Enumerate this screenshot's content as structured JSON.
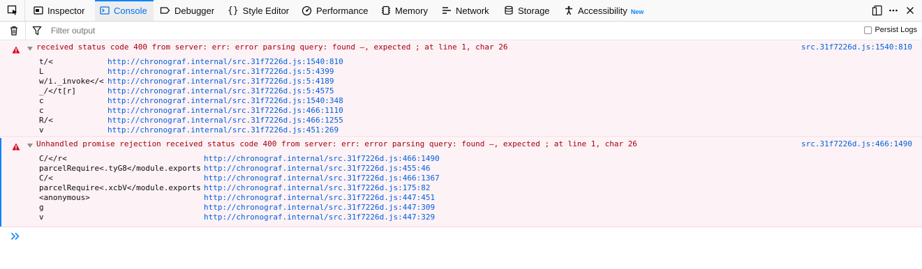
{
  "toolbar": {
    "tabs": [
      {
        "label": "Inspector"
      },
      {
        "label": "Console"
      },
      {
        "label": "Debugger"
      },
      {
        "label": "Style Editor"
      },
      {
        "label": "Performance"
      },
      {
        "label": "Memory"
      },
      {
        "label": "Network"
      },
      {
        "label": "Storage"
      },
      {
        "label": "Accessibility",
        "badge": "New"
      }
    ],
    "active_tab": "Console"
  },
  "filter": {
    "placeholder": "Filter output",
    "persist_logs_label": "Persist Logs",
    "persist_logs_checked": false
  },
  "messages": [
    {
      "level": "error",
      "text": "received status code 400 from server: err: error parsing query: found –, expected ; at line 1, char 26",
      "source": "src.31f7226d.js:1540:810",
      "stack": [
        {
          "fn": "t/<",
          "loc": "http://chronograf.internal/src.31f7226d.js:1540:810"
        },
        {
          "fn": "L",
          "loc": "http://chronograf.internal/src.31f7226d.js:5:4399"
        },
        {
          "fn": "w/i._invoke</<",
          "loc": "http://chronograf.internal/src.31f7226d.js:5:4189"
        },
        {
          "fn": "_/</t[r]",
          "loc": "http://chronograf.internal/src.31f7226d.js:5:4575"
        },
        {
          "fn": "c",
          "loc": "http://chronograf.internal/src.31f7226d.js:1540:348"
        },
        {
          "fn": "c",
          "loc": "http://chronograf.internal/src.31f7226d.js:466:1110"
        },
        {
          "fn": "R/<",
          "loc": "http://chronograf.internal/src.31f7226d.js:466:1255"
        },
        {
          "fn": "v",
          "loc": "http://chronograf.internal/src.31f7226d.js:451:269"
        }
      ]
    },
    {
      "level": "error",
      "text": "Unhandled promise rejection received status code 400 from server: err: error parsing query: found –, expected ; at line 1, char 26",
      "source": "src.31f7226d.js:466:1490",
      "stack": [
        {
          "fn": "C/</r<",
          "loc": "http://chronograf.internal/src.31f7226d.js:466:1490"
        },
        {
          "fn": "parcelRequire<.tyG8</module.exports",
          "loc": "http://chronograf.internal/src.31f7226d.js:455:46"
        },
        {
          "fn": "C/<",
          "loc": "http://chronograf.internal/src.31f7226d.js:466:1367"
        },
        {
          "fn": "parcelRequire<.xcbV</module.exports",
          "loc": "http://chronograf.internal/src.31f7226d.js:175:82"
        },
        {
          "fn": "<anonymous>",
          "loc": "http://chronograf.internal/src.31f7226d.js:447:451"
        },
        {
          "fn": "g",
          "loc": "http://chronograf.internal/src.31f7226d.js:447:309"
        },
        {
          "fn": "v",
          "loc": "http://chronograf.internal/src.31f7226d.js:447:329"
        }
      ]
    }
  ],
  "colors": {
    "accent": "#0a84ff",
    "error_text": "#a4000f",
    "error_bg": "#fdf2f5",
    "link": "#0060df"
  }
}
